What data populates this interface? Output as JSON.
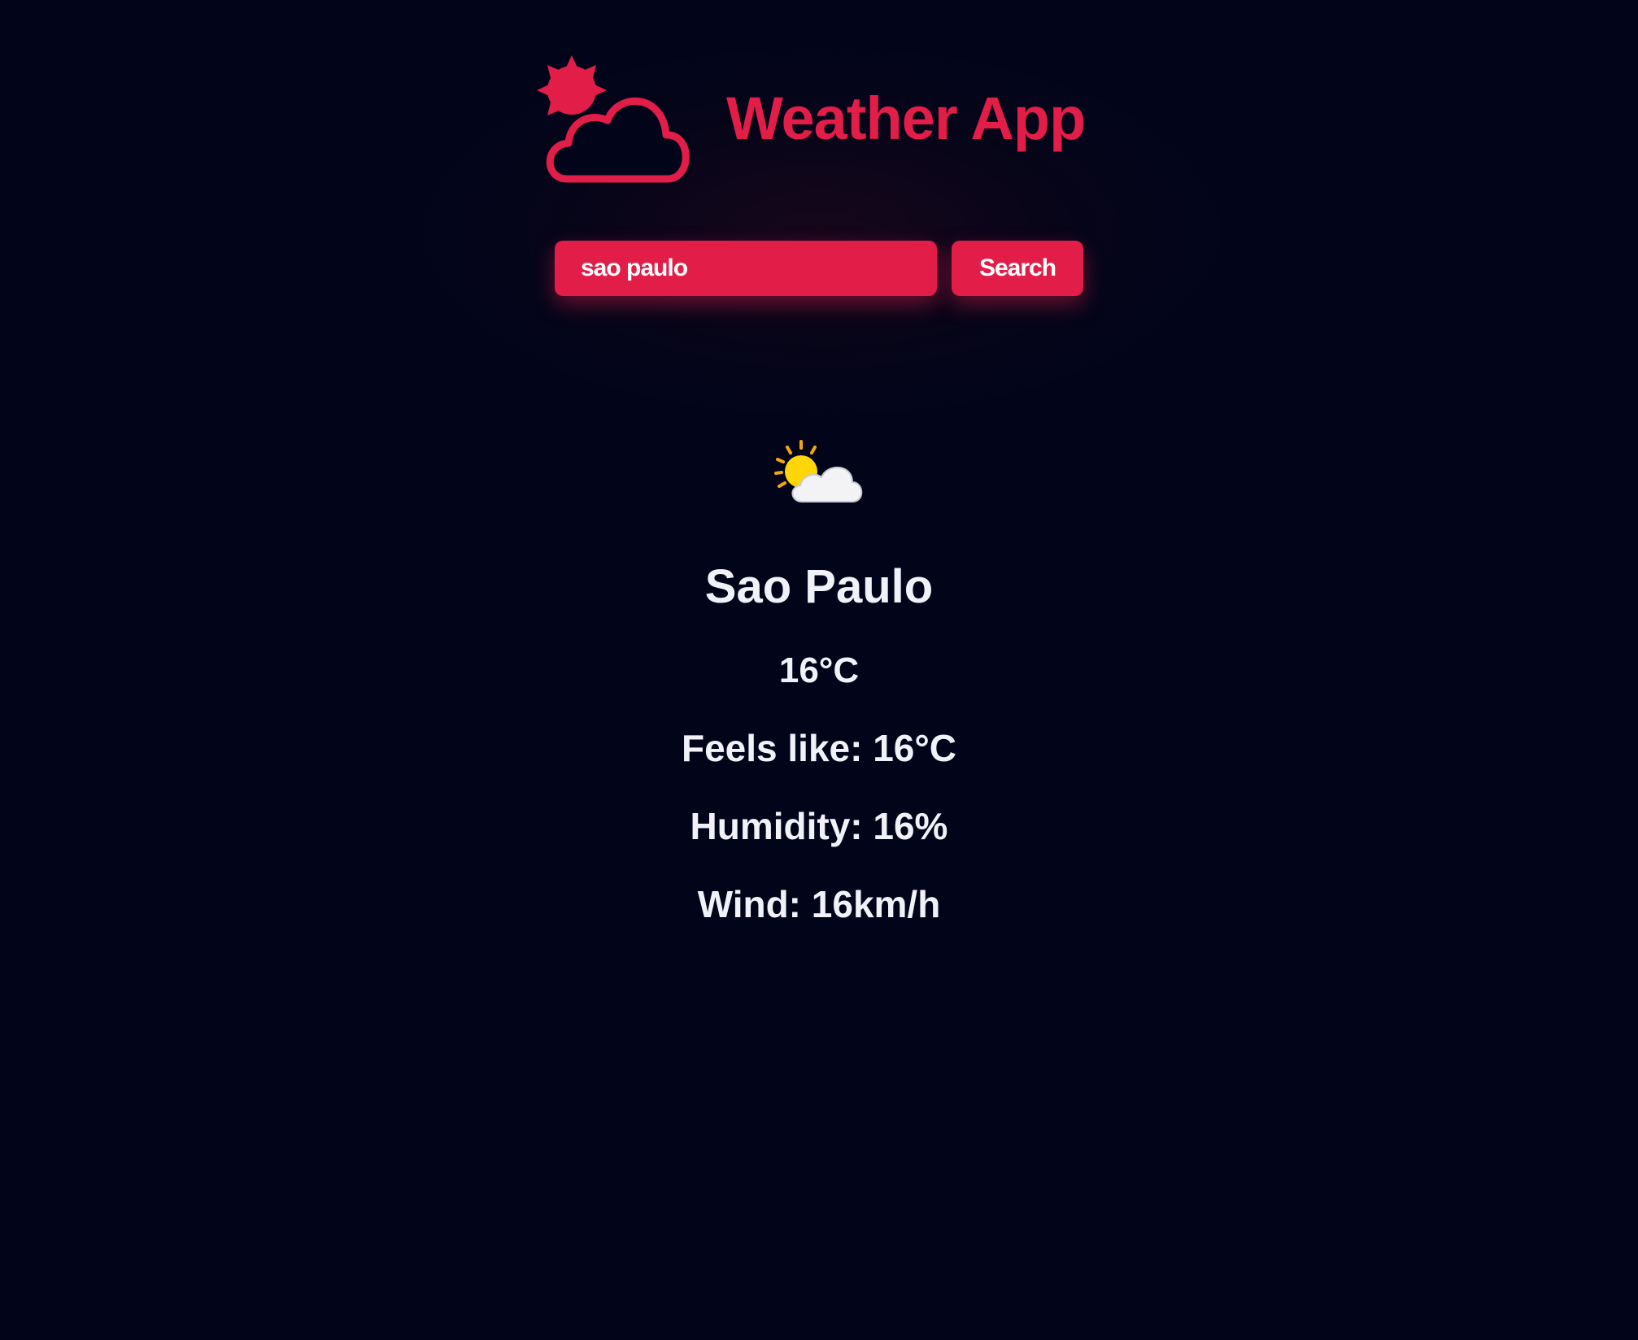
{
  "app": {
    "title": "Weather App",
    "logo_icon": "sun-cloud-outline-icon",
    "accent_color": "#e11d48",
    "background_color": "#02051a"
  },
  "search": {
    "value": "sao paulo",
    "button_label": "Search"
  },
  "weather": {
    "icon": "partly-cloudy-icon",
    "city": "Sao Paulo",
    "temperature": "16°C",
    "feels_like": "Feels like: 16°C",
    "humidity": "Humidity: 16%",
    "wind": "Wind: 16km/h"
  }
}
